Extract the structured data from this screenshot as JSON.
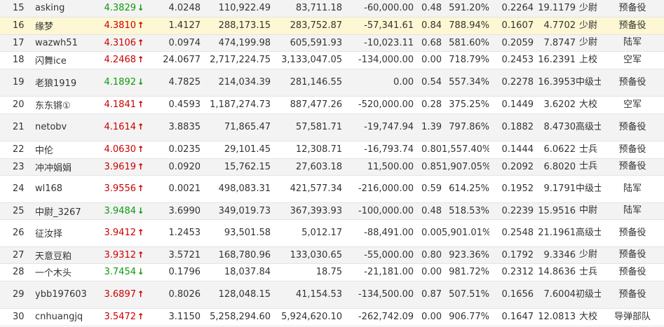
{
  "rows": [
    {
      "rank": "15",
      "name": "asking",
      "score": "4.3829",
      "trend": "down",
      "c1": "4.0248",
      "c2": "110,922.49",
      "c3": "83,711.18",
      "c4": "-60,000.00",
      "c5": "0.48",
      "c6": "591.20%",
      "c7": "0.2264",
      "c8": "19.1179",
      "title": "少尉",
      "branch": "预备役",
      "style": "odd",
      "h": 24
    },
    {
      "rank": "16",
      "name": "缘梦",
      "score": "4.3810",
      "trend": "up",
      "c1": "1.4127",
      "c2": "288,173.15",
      "c3": "283,752.87",
      "c4": "-57,341.61",
      "c5": "0.84",
      "c6": "788.94%",
      "c7": "0.1607",
      "c8": "4.7702",
      "title": "少尉",
      "branch": "预备役",
      "style": "hl",
      "h": 25
    },
    {
      "rank": "17",
      "name": "wazwh51",
      "score": "4.3106",
      "trend": "up",
      "c1": "0.0974",
      "c2": "474,199.98",
      "c3": "605,591.93",
      "c4": "-10,023.11",
      "c5": "0.68",
      "c6": "581.60%",
      "c7": "0.2059",
      "c8": "7.8747",
      "title": "少尉",
      "branch": "陆军",
      "style": "odd",
      "h": 24
    },
    {
      "rank": "18",
      "name": "闪舞ice",
      "score": "4.2468",
      "trend": "up",
      "c1": "24.0677",
      "c2": "2,717,224.75",
      "c3": "3,133,047.05",
      "c4": "-134,000.00",
      "c5": "0.00",
      "c6": "718.79%",
      "c7": "0.2453",
      "c8": "16.2391",
      "title": "上校",
      "branch": "空军",
      "style": "even",
      "h": 25
    },
    {
      "rank": "19",
      "name": "老狼1919",
      "score": "4.1892",
      "trend": "down",
      "c1": "4.7825",
      "c2": "214,034.39",
      "c3": "281,146.55",
      "c4": "0.00",
      "c5": "0.54",
      "c6": "557.34%",
      "c7": "0.2278",
      "c8": "16.3953",
      "title": "中级士官",
      "branch": "预备役",
      "style": "odd",
      "h": 39
    },
    {
      "rank": "20",
      "name": "东东锵①",
      "score": "4.1841",
      "trend": "up",
      "c1": "0.4593",
      "c2": "1,187,274.73",
      "c3": "887,477.26",
      "c4": "-520,000.00",
      "c5": "0.28",
      "c6": "375.25%",
      "c7": "0.1449",
      "c8": "3.6202",
      "title": "大校",
      "branch": "空军",
      "style": "even",
      "h": 25
    },
    {
      "rank": "21",
      "name": "netobv",
      "score": "4.1614",
      "trend": "up",
      "c1": "3.8835",
      "c2": "71,865.47",
      "c3": "57,581.71",
      "c4": "-19,747.94",
      "c5": "1.39",
      "c6": "797.86%",
      "c7": "0.1882",
      "c8": "8.4730",
      "title": "高级士官",
      "branch": "预备役",
      "style": "odd",
      "h": 39
    },
    {
      "rank": "22",
      "name": "中伦",
      "score": "4.0630",
      "trend": "up",
      "c1": "0.0235",
      "c2": "29,101.45",
      "c3": "12,308.71",
      "c4": "-16,793.74",
      "c5": "0.80",
      "c6": "1,557.40%",
      "c7": "0.1444",
      "c8": "6.0622",
      "title": "士兵",
      "branch": "预备役",
      "style": "even",
      "h": 25
    },
    {
      "rank": "23",
      "name": "冲冲娟娟",
      "score": "3.9619",
      "trend": "up",
      "c1": "0.0920",
      "c2": "15,762.15",
      "c3": "27,603.18",
      "c4": "11,500.00",
      "c5": "0.85",
      "c6": "1,907.05%",
      "c7": "0.2092",
      "c8": "6.8020",
      "title": "士兵",
      "branch": "预备役",
      "style": "odd",
      "h": 24
    },
    {
      "rank": "24",
      "name": "wl168",
      "score": "3.9556",
      "trend": "up",
      "c1": "0.0021",
      "c2": "498,083.31",
      "c3": "421,577.34",
      "c4": "-216,000.00",
      "c5": "0.59",
      "c6": "614.25%",
      "c7": "0.1952",
      "c8": "9.1791",
      "title": "中级士官",
      "branch": "陆军",
      "style": "even",
      "h": 39
    },
    {
      "rank": "25",
      "name": "中尉_3267",
      "score": "3.9484",
      "trend": "down",
      "c1": "3.6990",
      "c2": "349,019.73",
      "c3": "367,393.93",
      "c4": "-100,000.00",
      "c5": "0.48",
      "c6": "518.53%",
      "c7": "0.2239",
      "c8": "15.9516",
      "title": "中尉",
      "branch": "陆军",
      "style": "odd",
      "h": 24
    },
    {
      "rank": "26",
      "name": "征汝择",
      "score": "3.9412",
      "trend": "up",
      "c1": "1.2453",
      "c2": "93,501.58",
      "c3": "5,012.17",
      "c4": "-88,491.00",
      "c5": "0.00",
      "c6": "5,901.01%",
      "c7": "0.2548",
      "c8": "21.1961",
      "title": "高级士官",
      "branch": "预备役",
      "style": "even",
      "h": 39
    },
    {
      "rank": "27",
      "name": "天意豆粕",
      "score": "3.9312",
      "trend": "up",
      "c1": "3.5721",
      "c2": "168,780.96",
      "c3": "133,030.65",
      "c4": "-55,000.00",
      "c5": "0.80",
      "c6": "923.36%",
      "c7": "0.1792",
      "c8": "9.3346",
      "title": "少尉",
      "branch": "预备役",
      "style": "odd",
      "h": 24
    },
    {
      "rank": "28",
      "name": "一个木头",
      "score": "3.7454",
      "trend": "down",
      "c1": "0.1796",
      "c2": "18,037.84",
      "c3": "18.75",
      "c4": "-21,181.00",
      "c5": "0.00",
      "c6": "981.72%",
      "c7": "0.2312",
      "c8": "14.8636",
      "title": "士兵",
      "branch": "预备役",
      "style": "even",
      "h": 25
    },
    {
      "rank": "29",
      "name": "ybb197603",
      "score": "3.6897",
      "trend": "up",
      "c1": "0.8026",
      "c2": "128,048.15",
      "c3": "41,154.53",
      "c4": "-134,500.00",
      "c5": "0.87",
      "c6": "507.51%",
      "c7": "0.1656",
      "c8": "7.6004",
      "title": "初级士官",
      "branch": "预备役",
      "style": "odd",
      "h": 39
    },
    {
      "rank": "30",
      "name": "cnhuangjq",
      "score": "3.5472",
      "trend": "up",
      "c1": "3.1150",
      "c2": "5,258,294.60",
      "c3": "5,924,620.10",
      "c4": "-262,742.09",
      "c5": "0.00",
      "c6": "906.77%",
      "c7": "0.1647",
      "c8": "12.0813",
      "title": "大校",
      "branch": "导弹部队",
      "style": "even",
      "h": 25
    }
  ]
}
